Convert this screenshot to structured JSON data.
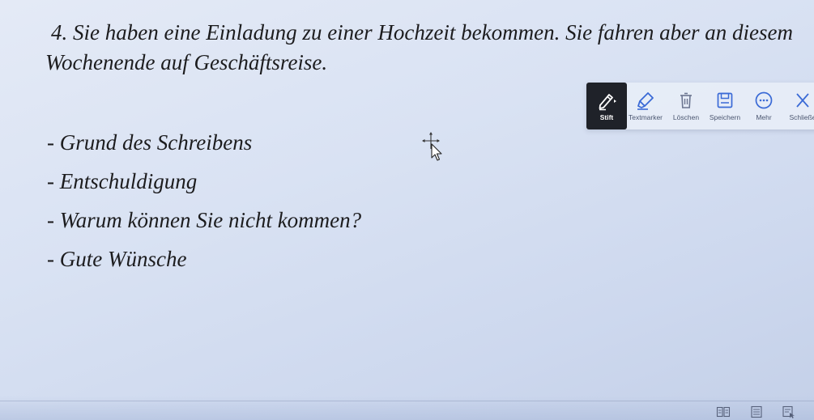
{
  "document": {
    "task_number": "4.",
    "task_text": "Sie haben eine Einladung zu einer Hochzeit bekommen. Sie fahren aber an diesem Wochenende auf Geschäftsreise.",
    "points": [
      "- Grund des Schreibens",
      "- Entschuldigung",
      "- Warum können Sie nicht kommen?",
      "- Gute Wünsche"
    ]
  },
  "toolbar": {
    "pen_label": "Stift",
    "highlighter_label": "Textmarker",
    "delete_label": "Löschen",
    "save_label": "Speichern",
    "more_label": "Mehr",
    "close_label": "Schließe",
    "accent_color": "#3a6ad6",
    "active_bg": "#1f2229"
  },
  "status_bar": {
    "icons": [
      "read-mode-icon",
      "print-layout-icon",
      "web-layout-icon"
    ]
  }
}
